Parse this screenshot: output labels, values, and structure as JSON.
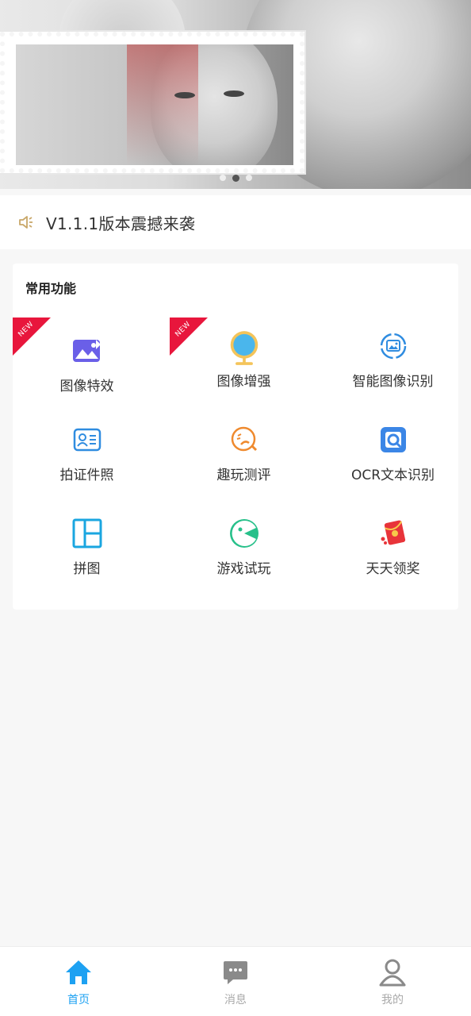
{
  "banner": {
    "slides": 3,
    "active_index": 1
  },
  "notice": {
    "icon": "speaker-icon",
    "text": "V1.1.1版本震撼来袭"
  },
  "section": {
    "title": "常用功能",
    "items": [
      {
        "label": "图像特效",
        "icon": "image-effect-icon",
        "badge": "NEW"
      },
      {
        "label": "图像增强",
        "icon": "mirror-enhance-icon",
        "badge": "NEW"
      },
      {
        "label": "智能图像识别",
        "icon": "image-recognition-icon"
      },
      {
        "label": "拍证件照",
        "icon": "id-card-icon"
      },
      {
        "label": "趣玩测评",
        "icon": "fun-test-icon"
      },
      {
        "label": "OCR文本识别",
        "icon": "ocr-scan-icon"
      },
      {
        "label": "拼图",
        "icon": "collage-icon"
      },
      {
        "label": "游戏试玩",
        "icon": "game-icon"
      },
      {
        "label": "天天领奖",
        "icon": "red-envelope-icon"
      }
    ]
  },
  "tabbar": {
    "tabs": [
      {
        "label": "首页",
        "icon": "home-icon",
        "active": true
      },
      {
        "label": "消息",
        "icon": "message-icon",
        "active": false
      },
      {
        "label": "我的",
        "icon": "profile-icon",
        "active": false
      }
    ]
  },
  "colors": {
    "accent": "#1da1f2",
    "badge": "#e8163c",
    "notice_icon": "#c9a86a"
  }
}
